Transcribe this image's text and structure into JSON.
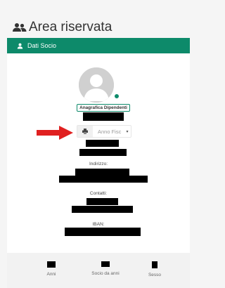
{
  "page": {
    "title": "Area riservata",
    "title_icon": "users-icon"
  },
  "card": {
    "header_icon": "user-icon",
    "header_title": "Dati Socio",
    "header_color": "#0d8a6a"
  },
  "profile": {
    "avatar_icon": "avatar-placeholder",
    "status_color": "#0d8a6a",
    "badge_label": "Anagrafica Dipendenti",
    "select_icon": "print-icon",
    "select_placeholder": "Anno Fisc",
    "select_caret": "▾",
    "indirizzo_label": "Indirizzo:",
    "contatti_label": "Contatti:",
    "iban_label": "IBAN:"
  },
  "annotation": {
    "arrow_color": "#e02020"
  },
  "stats": [
    {
      "label": "Anni"
    },
    {
      "label": "Socio da anni"
    },
    {
      "label": "Sesso"
    }
  ]
}
